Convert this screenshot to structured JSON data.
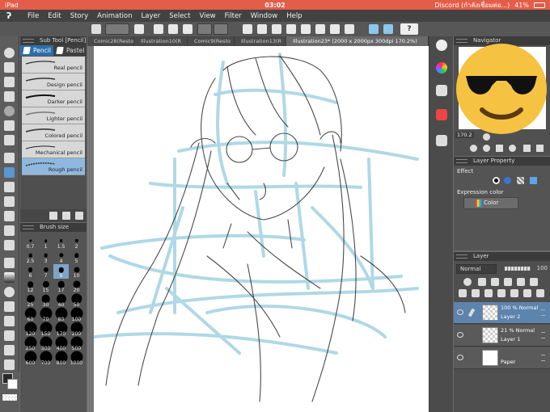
{
  "status_bar": {
    "device": "iPad",
    "time": "03:02",
    "right_text": "Discord (กำลังเชื่อมต่อ...)",
    "battery": "41%"
  },
  "menu": {
    "items": [
      "File",
      "Edit",
      "Story",
      "Animation",
      "Layer",
      "Select",
      "View",
      "Filter",
      "Window",
      "Help"
    ]
  },
  "toolbar": {
    "help_label": "?"
  },
  "sub_tool": {
    "title": "Sub Tool [Pencil]",
    "tabs": [
      "Pencil",
      "Pastel"
    ],
    "brushes": [
      "Real pencil",
      "Design pencil",
      "Darker pencil",
      "Lighter pencil",
      "Colored pencil",
      "Mechanical pencil",
      "Rough pencil"
    ],
    "selected": "Rough pencil"
  },
  "brush_size": {
    "title": "Brush size",
    "sizes": [
      "0.7",
      "1",
      "1.5",
      "2",
      "2.5",
      "3",
      "4",
      "5",
      "6",
      "7",
      "8",
      "10",
      "12",
      "15",
      "17",
      "20",
      "25",
      "30",
      "40",
      "50",
      "60",
      "70",
      "80",
      "100",
      "120",
      "150",
      "170",
      "200",
      "250",
      "300",
      "400",
      "500",
      "600",
      "700",
      "800",
      "1000"
    ],
    "selected": "8"
  },
  "doc_tabs": [
    "Comic28(Resto",
    "Illustration10(R",
    "Comic9(Resto",
    "Illustration13(R",
    "Illustration23* (2000 x 2000px 300dpi 170.2%)"
  ],
  "navigator": {
    "title": "Navigator",
    "zoom": "170.2"
  },
  "layer_property": {
    "title": "Layer Property",
    "effect_label": "Effect",
    "expression_color_label": "Expression color",
    "expression_color_value": "Color"
  },
  "layer_panel": {
    "title": "Layer",
    "blend_mode": "Normal",
    "opacity": "100",
    "layers": [
      {
        "opacity_mode": "100 % Normal",
        "name": "Layer 2",
        "selected": true
      },
      {
        "opacity_mode": "21 % Normal",
        "name": "Layer 1",
        "selected": false
      },
      {
        "opacity_mode": "",
        "name": "Paper",
        "selected": false
      }
    ]
  },
  "colors": {
    "accent_blue": "#2c6fa8",
    "statusbar": "#e45d48",
    "sketch_blue": "#a8d4e4"
  }
}
